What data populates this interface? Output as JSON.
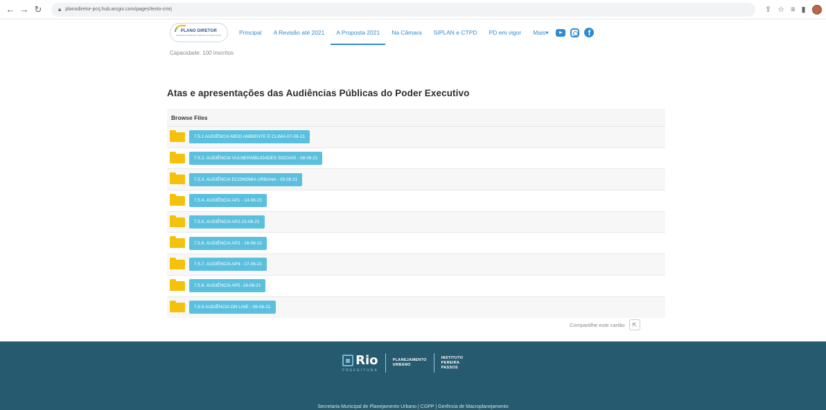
{
  "browser": {
    "url": "planodiretor-pcrj.hub.arcgis.com/pages/texto-cmrj"
  },
  "header": {
    "logo_line1": "PLANO DIRETOR",
    "logo_line2": "DESENVOLVIMENTO URBANO SUSTENTÁVEL",
    "menu": [
      {
        "label": "Principal"
      },
      {
        "label": "A Revisão até 2021"
      },
      {
        "label": "A Proposta 2021",
        "active": true
      },
      {
        "label": "Na Câmara"
      },
      {
        "label": "SIPLAN e CTPD"
      },
      {
        "label": "PD em vigor"
      },
      {
        "label": "Mais▾"
      }
    ]
  },
  "capacity": "Capacidade: 100 inscritos",
  "section_title": "Atas e apresentações das Audiências Públicas do Poder Executivo",
  "browse_files": {
    "header": "Browse Files",
    "folders": [
      "7.5.1 AUDIÊNCIA MEIO AMBIENTE E CLIMA-07-06-21",
      "7.5.2. AUDIÊNCIA VULNERABILIDADES SOCIAIS - 08.06.21",
      "7.5.3. AUDIÊNCIA ECONOMIA URBANA - 09.06.21",
      "7.5.4. AUDIÊNCIA AP1 - 14-06-21",
      "7.5.5. AUDIÊNCIA AP2-15-06-21",
      "7.5.6. AUDIÊNCIA AP3 - 16-06-21",
      "7.5.7. AUDIÊNCIA AP4 - 17-06-21",
      "7.5.8. AUDIÊNCIA AP5 -18-06-21",
      "7.5.9 AUDIÊNCIA ON LINE - 09-06-21"
    ]
  },
  "share_label": "Compartilhe este cartão",
  "footer": {
    "rio": "Rio",
    "prefeitura": "PREFEITURA",
    "planejamento": [
      "PLANEJAMENTO",
      "URBANO"
    ],
    "instituto": [
      "INSTITUTO",
      "PEREIRA",
      "PASSOS"
    ],
    "bottom_text": "Secretaria Municipal de Planejamento Urbano | CGPP | Gerência de Macroplanejamento"
  }
}
